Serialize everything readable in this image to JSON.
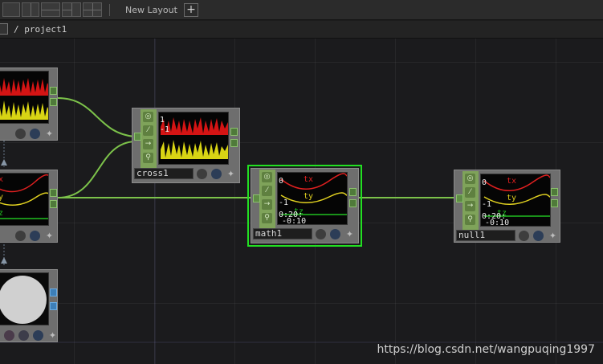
{
  "topbar": {
    "new_layout_label": "New Layout",
    "add_layout_button": "+"
  },
  "pathbar": {
    "path": "/ project1"
  },
  "nodes": {
    "cross": {
      "name": "cross1"
    },
    "math": {
      "name": "math1"
    },
    "null": {
      "name": "null1"
    }
  },
  "channels": {
    "tx": "tx",
    "ty": "ty",
    "tz": "tz",
    "v0": "0",
    "v1": "1",
    "vm1": "-1",
    "t1": "0:20:",
    "t2": "-0:10"
  },
  "colors": {
    "selected": "#22e022",
    "wire": "#7cc24a",
    "chop_green": "#7fa35a"
  },
  "watermark": "https://blog.csdn.net/wangpuqing1997"
}
